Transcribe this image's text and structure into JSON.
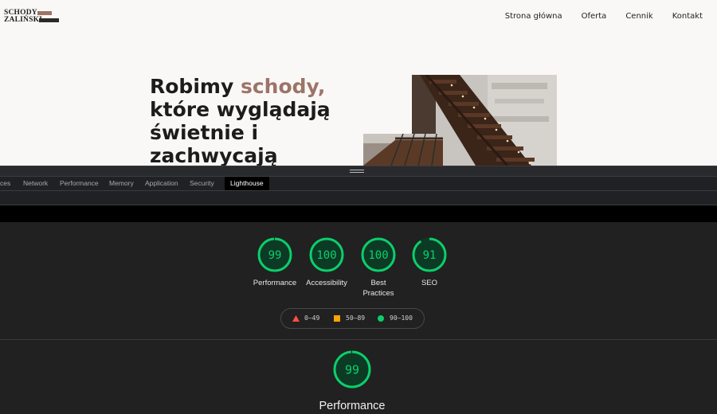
{
  "site": {
    "logo": {
      "line1": "SCHODY",
      "line2": "ZALIŃSKI"
    },
    "nav": [
      "Strona główna",
      "Oferta",
      "Cennik",
      "Kontakt"
    ],
    "hero": {
      "line1_pre": "Robimy ",
      "line1_accent": "schody,",
      "line2": "które wyglądają",
      "line3": "świetnie i",
      "line4": "zachwycają"
    },
    "colors": {
      "accent": "#9c7468",
      "text": "#1c1c1c",
      "background": "#faf8f7"
    }
  },
  "devtools": {
    "tabs": [
      "ces",
      "Network",
      "Performance",
      "Memory",
      "Application",
      "Security",
      "Lighthouse"
    ],
    "active_tab": "Lighthouse"
  },
  "lighthouse": {
    "scores": [
      {
        "label": "Performance",
        "value": 99
      },
      {
        "label": "Accessibility",
        "value": 100
      },
      {
        "label": "Best Practices",
        "value": 100
      },
      {
        "label": "SEO",
        "value": 91
      }
    ],
    "legend": [
      {
        "range": "0–49",
        "icon": "red-triangle-icon",
        "color": "#ff4e42"
      },
      {
        "range": "50–89",
        "icon": "orange-square-icon",
        "color": "#ffa400"
      },
      {
        "range": "90–100",
        "icon": "green-circle-icon",
        "color": "#0cce6b"
      }
    ],
    "detail": {
      "score": 99,
      "title": "Performance"
    },
    "colors": {
      "pass": "#0cce6b",
      "pass_bg": "#0d3a25"
    }
  }
}
